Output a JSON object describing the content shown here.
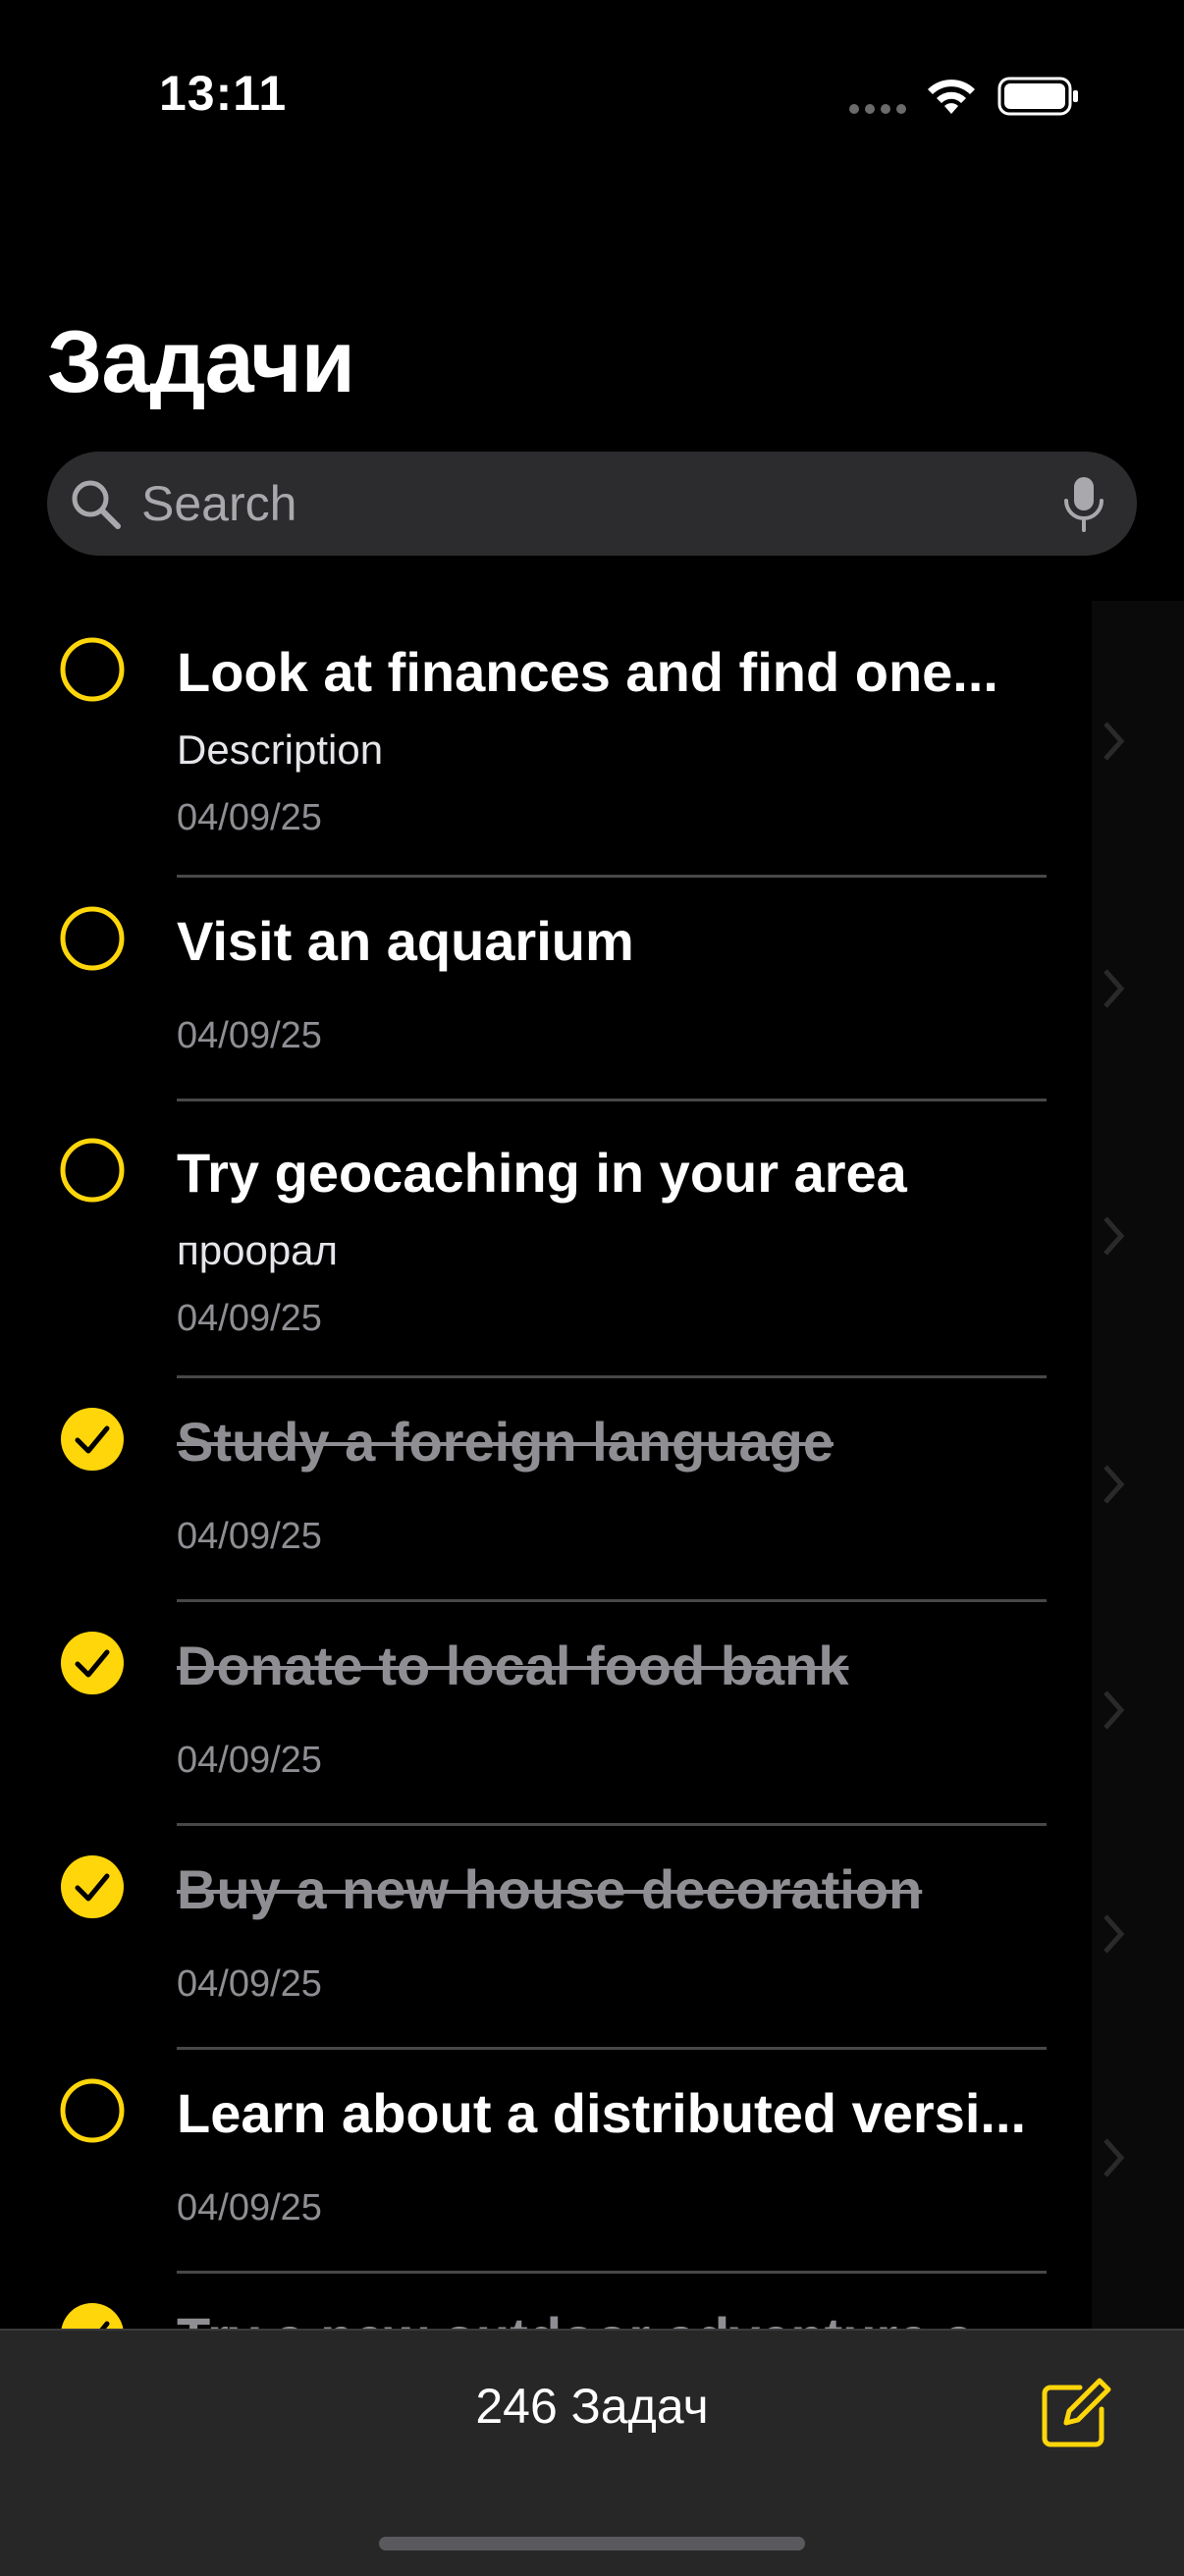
{
  "status": {
    "time": "13:11"
  },
  "header": {
    "title": "Задачи"
  },
  "search": {
    "placeholder": "Search"
  },
  "accent": "#FFD60A",
  "tasks": [
    {
      "title": "Look at finances and find one...",
      "description": "Description",
      "date": "04/09/25",
      "done": false
    },
    {
      "title": "Visit an aquarium",
      "description": "",
      "date": "04/09/25",
      "done": false
    },
    {
      "title": "Try geocaching in your area",
      "description": "проорал",
      "date": "04/09/25",
      "done": false
    },
    {
      "title": "Study a foreign language",
      "description": "",
      "date": "04/09/25",
      "done": true
    },
    {
      "title": "Donate to local food bank",
      "description": "",
      "date": "04/09/25",
      "done": true
    },
    {
      "title": "Buy a new house decoration",
      "description": "",
      "date": "04/09/25",
      "done": true
    },
    {
      "title": "Learn about a distributed versi...",
      "description": "",
      "date": "04/09/25",
      "done": false
    },
    {
      "title": "Try a new outdoor adventure a...",
      "description": "",
      "date": "",
      "done": true
    }
  ],
  "footer": {
    "count": "246 Задач"
  }
}
